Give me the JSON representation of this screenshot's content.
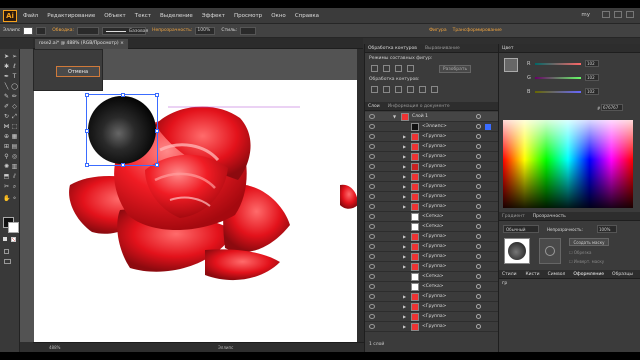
{
  "app": {
    "logo": "Ai",
    "workspace": "my"
  },
  "menu": [
    "Файл",
    "Редактирование",
    "Объект",
    "Текст",
    "Выделение",
    "Эффект",
    "Просмотр",
    "Окно",
    "Справка"
  ],
  "control": {
    "left_label": "Эллипс",
    "stroke_label": "Обводка:",
    "brush_label": "Базовая",
    "opacity_label": "Непрозрачность:",
    "opacity_value": "100%",
    "style_label": "Стиль:",
    "shape_label": "Фигура",
    "transform_label": "Трансформирование"
  },
  "tab": {
    "title": "rose2.ai* @ 488% (RGB/Просмотр)",
    "close": "×"
  },
  "dialog": {
    "cancel_label": "Отмена"
  },
  "status": {
    "zoom": "488%",
    "tool": "Эллипс"
  },
  "pathfinder": {
    "title": "Обработка контуров",
    "alt_tab": "Выравнивание",
    "modes_label": "Режимы составных фигур:",
    "expand_label": "Разобрать",
    "pathfinders_label": "Обработка контуров:"
  },
  "layers": {
    "tab": "Слои",
    "alt_tab": "Информация о документе",
    "layer_name": "Слой 1",
    "rows": [
      "<Эллипс>",
      "<Группа>",
      "<Группа>",
      "<Группа>",
      "<Группа>",
      "<Группа>",
      "<Группа>",
      "<Группа>",
      "<Группа>",
      "<Сетка>",
      "<Сетка>",
      "<Группа>",
      "<Группа>",
      "<Группа>",
      "<Группа>",
      "<Сетка>",
      "<Сетка>",
      "<Группа>",
      "<Группа>",
      "<Группа>",
      "<Группа>"
    ],
    "footer": "1 слой"
  },
  "color": {
    "tab": "Цвет",
    "r_label": "R",
    "g_label": "G",
    "b_label": "B",
    "r_value": "102",
    "g_value": "102",
    "b_value": "102",
    "hex": "676767",
    "accent": "#f7a21b"
  },
  "gradient": {
    "tab": "Градиент",
    "tab2": "Прозрачность",
    "mode": "Обычный",
    "opacity_label": "Непрозрачность:",
    "opacity_value": "100%",
    "make_mask": "Создать маску",
    "clip": "Обрезка",
    "invert": "Инверт. маску"
  },
  "lower_tabs": [
    "Стили гр",
    "Кисти",
    "Символ",
    "Оформление",
    "Образцы"
  ]
}
